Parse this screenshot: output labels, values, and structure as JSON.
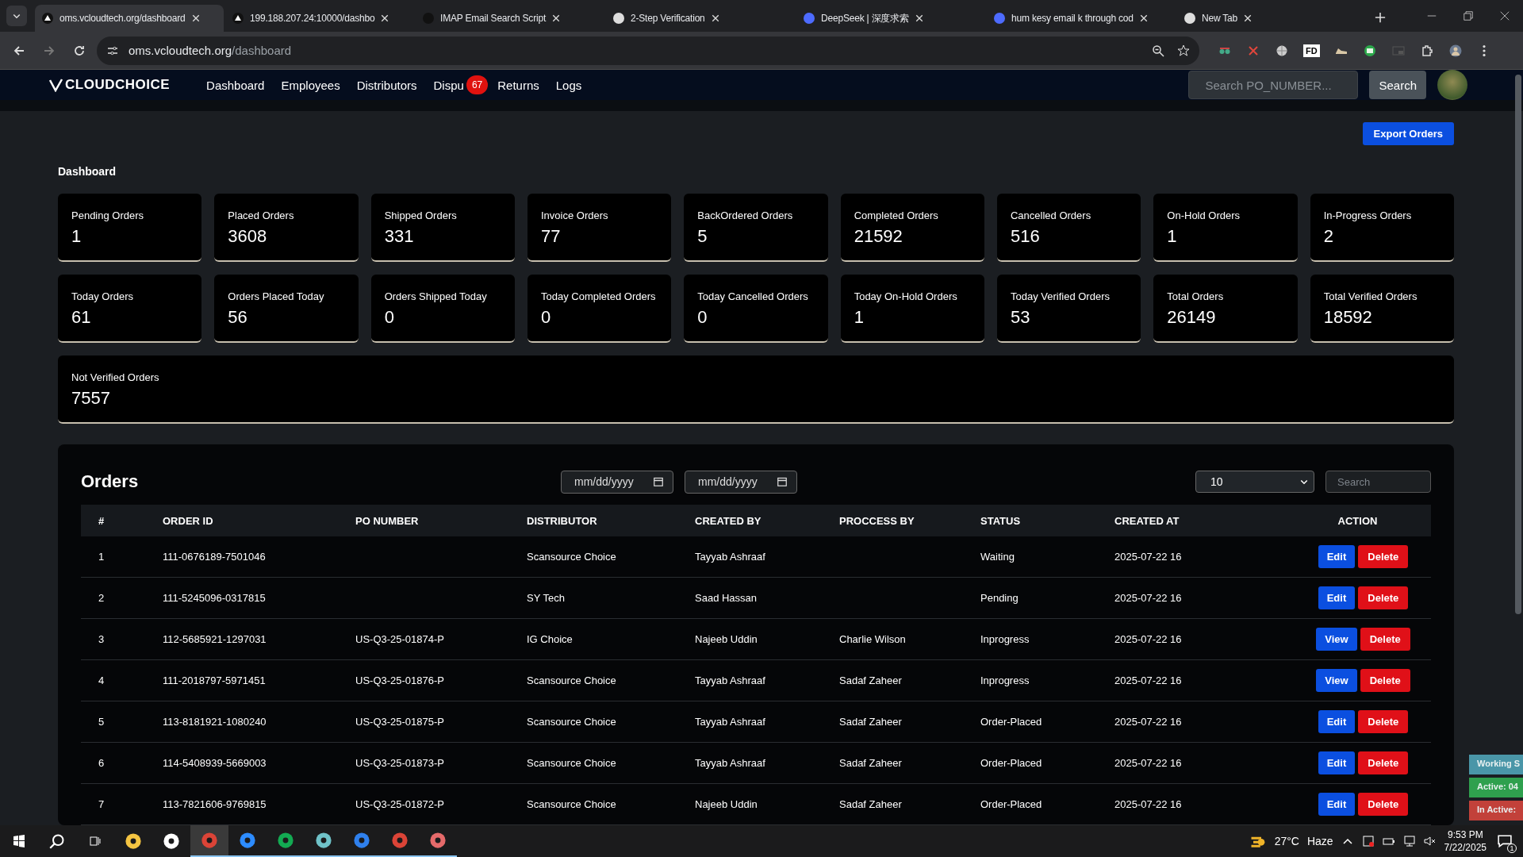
{
  "browser": {
    "tabs": [
      {
        "title": "oms.vcloudtech.org/dashboard",
        "selected": true
      },
      {
        "title": "199.188.207.24:10000/dashbo",
        "selected": false
      },
      {
        "title": "IMAP Email Search Script",
        "selected": false
      },
      {
        "title": "2-Step Verification",
        "selected": false
      },
      {
        "title": "DeepSeek | 深度求索",
        "selected": false
      },
      {
        "title": "hum kesy email k through cod",
        "selected": false
      },
      {
        "title": "New Tab",
        "selected": false
      }
    ],
    "address": {
      "host": "oms.vcloudtech.org",
      "path": "/dashboard"
    },
    "extension_label": "FD"
  },
  "nav": {
    "logo": "CLOUDCHOICE",
    "links": [
      {
        "label": "Dashboard"
      },
      {
        "label": "Employees"
      },
      {
        "label": "Distributors"
      },
      {
        "label": "Dispu",
        "badge": "67"
      },
      {
        "label": "Returns"
      },
      {
        "label": "Logs"
      }
    ],
    "search": {
      "placeholder": "Search PO_NUMBER...",
      "button": "Search"
    }
  },
  "export_button": "Export Orders",
  "dashboard": {
    "title": "Dashboard",
    "stat_rows": [
      [
        {
          "label": "Pending Orders",
          "value": "1"
        },
        {
          "label": "Placed Orders",
          "value": "3608"
        },
        {
          "label": "Shipped Orders",
          "value": "331"
        },
        {
          "label": "Invoice Orders",
          "value": "77"
        },
        {
          "label": "BackOrdered Orders",
          "value": "5"
        },
        {
          "label": "Completed Orders",
          "value": "21592"
        },
        {
          "label": "Cancelled Orders",
          "value": "516"
        },
        {
          "label": "On-Hold Orders",
          "value": "1"
        },
        {
          "label": "In-Progress Orders",
          "value": "2"
        }
      ],
      [
        {
          "label": "Today Orders",
          "value": "61"
        },
        {
          "label": "Orders Placed Today",
          "value": "56"
        },
        {
          "label": "Orders Shipped Today",
          "value": "0"
        },
        {
          "label": "Today Completed Orders",
          "value": "0"
        },
        {
          "label": "Today Cancelled Orders",
          "value": "0"
        },
        {
          "label": "Today On-Hold Orders",
          "value": "1"
        },
        {
          "label": "Today Verified Orders",
          "value": "53"
        },
        {
          "label": "Total Orders",
          "value": "26149"
        },
        {
          "label": "Total Verified Orders",
          "value": "18592"
        }
      ],
      [
        {
          "label": "Not Verified Orders",
          "value": "7557"
        }
      ]
    ]
  },
  "orders": {
    "title": "Orders",
    "date_from": {
      "placeholder": "mm/dd/yyyy"
    },
    "date_to": {
      "placeholder": "mm/dd/yyyy"
    },
    "page_size": "10",
    "search": {
      "placeholder": "Search"
    },
    "columns": [
      "#",
      "ORDER ID",
      "PO NUMBER",
      "DISTRIBUTOR",
      "CREATED BY",
      "PROCCESS BY",
      "STATUS",
      "CREATED AT",
      "ACTION"
    ],
    "rows": [
      {
        "cells": [
          "1",
          "111-0676189-7501046",
          "",
          "Scansource Choice",
          "Tayyab Ashraaf",
          "",
          "Waiting",
          "2025-07-22 16"
        ],
        "actions": [
          {
            "label": "Edit",
            "kind": "primary"
          },
          {
            "label": "Delete",
            "kind": "danger"
          }
        ]
      },
      {
        "cells": [
          "2",
          "111-5245096-0317815",
          "",
          "SY Tech",
          "Saad Hassan",
          "",
          "Pending",
          "2025-07-22 16"
        ],
        "actions": [
          {
            "label": "Edit",
            "kind": "primary"
          },
          {
            "label": "Delete",
            "kind": "danger"
          }
        ]
      },
      {
        "cells": [
          "3",
          "112-5685921-1297031",
          "US-Q3-25-01874-P",
          "IG Choice",
          "Najeeb Uddin",
          "Charlie Wilson",
          "Inprogress",
          "2025-07-22 16"
        ],
        "actions": [
          {
            "label": "View",
            "kind": "primary"
          },
          {
            "label": "Delete",
            "kind": "danger"
          }
        ]
      },
      {
        "cells": [
          "4",
          "111-2018797-5971451",
          "US-Q3-25-01876-P",
          "Scansource Choice",
          "Tayyab Ashraaf",
          "Sadaf Zaheer",
          "Inprogress",
          "2025-07-22 16"
        ],
        "actions": [
          {
            "label": "View",
            "kind": "primary"
          },
          {
            "label": "Delete",
            "kind": "danger"
          }
        ]
      },
      {
        "cells": [
          "5",
          "113-8181921-1080240",
          "US-Q3-25-01875-P",
          "Scansource Choice",
          "Tayyab Ashraaf",
          "Sadaf Zaheer",
          "Order-Placed",
          "2025-07-22 16"
        ],
        "actions": [
          {
            "label": "Edit",
            "kind": "primary"
          },
          {
            "label": "Delete",
            "kind": "danger"
          }
        ]
      },
      {
        "cells": [
          "6",
          "114-5408939-5669003",
          "US-Q3-25-01873-P",
          "Scansource Choice",
          "Tayyab Ashraaf",
          "Sadaf Zaheer",
          "Order-Placed",
          "2025-07-22 16"
        ],
        "actions": [
          {
            "label": "Edit",
            "kind": "primary"
          },
          {
            "label": "Delete",
            "kind": "danger"
          }
        ]
      },
      {
        "cells": [
          "7",
          "113-7821606-9769815",
          "US-Q3-25-01872-P",
          "Scansource Choice",
          "Najeeb Uddin",
          "Sadaf Zaheer",
          "Order-Placed",
          "2025-07-22 16"
        ],
        "actions": [
          {
            "label": "Edit",
            "kind": "primary"
          },
          {
            "label": "Delete",
            "kind": "danger"
          }
        ]
      }
    ]
  },
  "status_widgets": [
    {
      "label": "Working S",
      "color": "#4a96a8"
    },
    {
      "label": "Active: 04",
      "color": "#2fa04e"
    },
    {
      "label": "In Active:",
      "color": "#c2413a"
    }
  ],
  "taskbar": {
    "temperature": "27°C",
    "weather": "Haze",
    "time": "9:53 PM",
    "date": "7/22/2025",
    "notifications": "1"
  }
}
